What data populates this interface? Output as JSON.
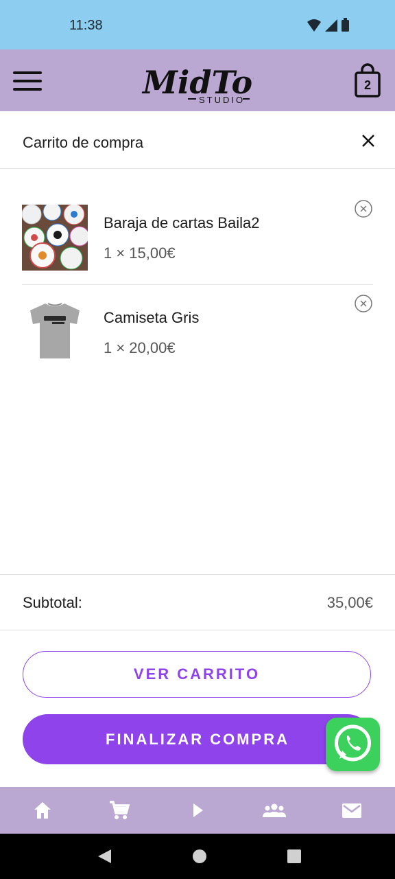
{
  "status_bar": {
    "time": "11:38"
  },
  "app_bar": {
    "logo_text": "MidTown",
    "logo_subtext": "STUDIO",
    "cart_count": "2"
  },
  "cart_panel": {
    "title": "Carrito de compra",
    "items": [
      {
        "name": "Baraja de cartas Baila2",
        "price": "1 × 15,00€"
      },
      {
        "name": "Camiseta Gris",
        "price": "1 × 20,00€"
      }
    ],
    "subtotal_label": "Subtotal:",
    "subtotal_value": "35,00€",
    "view_cart_label": "VER CARRITO",
    "checkout_label": "FINALIZAR COMPRA"
  },
  "bottom_nav": {
    "items": [
      "home-icon",
      "cart-icon",
      "play-icon",
      "group-icon",
      "mail-icon"
    ]
  },
  "colors": {
    "accent": "#8e44ea",
    "app_bar": "#bba8d2",
    "status_bar": "#8dcdf0",
    "whatsapp": "#3cd05d"
  }
}
